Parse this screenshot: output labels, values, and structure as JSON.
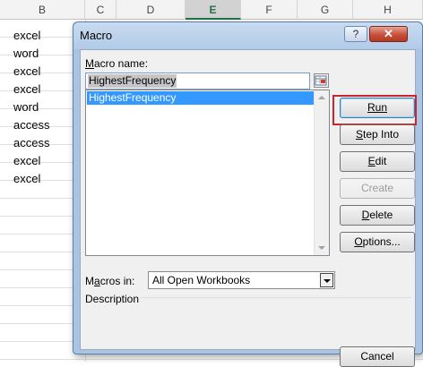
{
  "sheet": {
    "columns": [
      {
        "label": "B",
        "selected": false
      },
      {
        "label": "C",
        "selected": false
      },
      {
        "label": "D",
        "selected": false
      },
      {
        "label": "E",
        "selected": true
      },
      {
        "label": "F",
        "selected": false
      },
      {
        "label": "G",
        "selected": false
      },
      {
        "label": "H",
        "selected": false
      }
    ],
    "cells": [
      "excel",
      "word",
      "excel",
      "excel",
      "word",
      "access",
      "access",
      "excel",
      "excel"
    ]
  },
  "dialog": {
    "title": "Macro",
    "help_label": "?",
    "close_label": "✕",
    "macro_name_label": "Macro name:",
    "macro_name_value": "HighestFrequency",
    "list_items": [
      "HighestFrequency"
    ],
    "buttons": {
      "run": "Run",
      "step_into": "Step Into",
      "edit": "Edit",
      "create": "Create",
      "delete": "Delete",
      "options": "Options...",
      "cancel": "Cancel"
    },
    "macros_in_label": "Macros in:",
    "macros_in_value": "All Open Workbooks",
    "description_label": "Description"
  }
}
